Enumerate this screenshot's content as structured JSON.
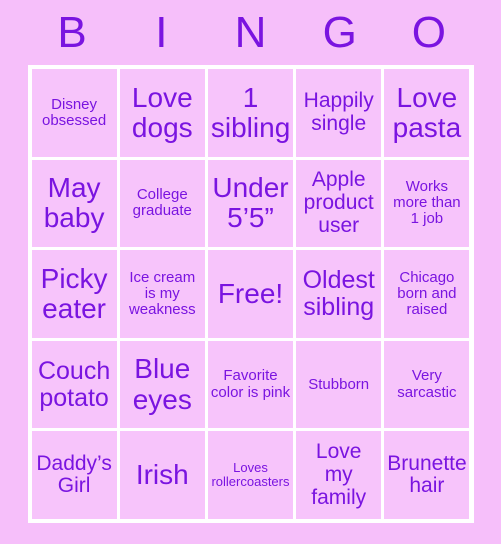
{
  "colors": {
    "background": "#f6bffa",
    "cell_fill": "#f7c4fb",
    "grid_line": "#ffffff",
    "text": "#7a14e0"
  },
  "header": {
    "letters": [
      "B",
      "I",
      "N",
      "G",
      "O"
    ]
  },
  "grid": {
    "rows": [
      [
        {
          "text": "Disney obsessed",
          "size": "sm"
        },
        {
          "text": "Love dogs",
          "size": "xl"
        },
        {
          "text": "1 sibling",
          "size": "xl"
        },
        {
          "text": "Happily single",
          "size": "md"
        },
        {
          "text": "Love pasta",
          "size": "xl"
        }
      ],
      [
        {
          "text": "May baby",
          "size": "xl"
        },
        {
          "text": "College graduate",
          "size": "sm"
        },
        {
          "text": "Under 5’5”",
          "size": "xl"
        },
        {
          "text": "Apple product user",
          "size": "md"
        },
        {
          "text": "Works more than 1 job",
          "size": "sm"
        }
      ],
      [
        {
          "text": "Picky eater",
          "size": "xl"
        },
        {
          "text": "Ice cream is my weakness",
          "size": "sm"
        },
        {
          "text": "Free!",
          "size": "xl"
        },
        {
          "text": "Oldest sibling",
          "size": "lg"
        },
        {
          "text": "Chicago born and raised",
          "size": "sm"
        }
      ],
      [
        {
          "text": "Couch potato",
          "size": "lg"
        },
        {
          "text": "Blue eyes",
          "size": "xl"
        },
        {
          "text": "Favorite color is pink",
          "size": "sm"
        },
        {
          "text": "Stubborn",
          "size": "sm"
        },
        {
          "text": "Very sarcastic",
          "size": "sm"
        }
      ],
      [
        {
          "text": "Daddy’s Girl",
          "size": "md"
        },
        {
          "text": "Irish",
          "size": "xl"
        },
        {
          "text": "Loves rollercoasters",
          "size": "xs"
        },
        {
          "text": "Love my family",
          "size": "md"
        },
        {
          "text": "Brunette hair",
          "size": "md"
        }
      ]
    ]
  }
}
